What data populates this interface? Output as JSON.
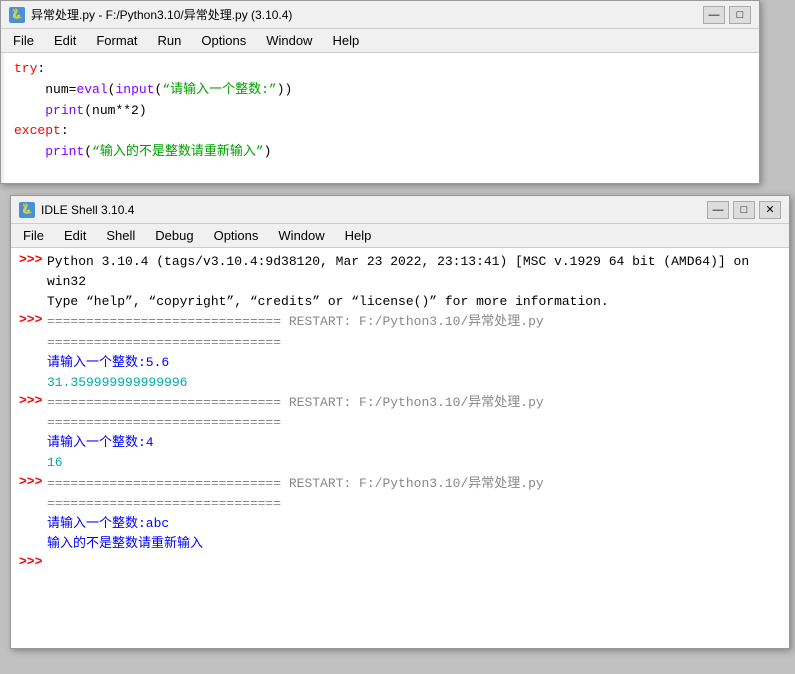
{
  "editor": {
    "titlebar": {
      "title": "异常处理.py - F:/Python3.10/异常处理.py (3.10.4)",
      "icon_label": "py"
    },
    "menu": [
      "File",
      "Edit",
      "Format",
      "Run",
      "Options",
      "Window",
      "Help"
    ],
    "code_lines": [
      {
        "indent": 0,
        "parts": [
          {
            "text": "try",
            "color": "red"
          },
          {
            "text": ":",
            "color": "black"
          }
        ]
      },
      {
        "indent": 1,
        "parts": [
          {
            "text": "num",
            "color": "black"
          },
          {
            "text": "=",
            "color": "black"
          },
          {
            "text": "eval",
            "color": "purple"
          },
          {
            "text": "(",
            "color": "black"
          },
          {
            "text": "input",
            "color": "purple"
          },
          {
            "text": "(",
            "color": "black"
          },
          {
            "text": "“请输入一个整数:”",
            "color": "green"
          },
          {
            "text": "))",
            "color": "black"
          }
        ]
      },
      {
        "indent": 1,
        "parts": [
          {
            "text": "print",
            "color": "purple"
          },
          {
            "text": "(",
            "color": "black"
          },
          {
            "text": "num**2",
            "color": "black"
          },
          {
            "text": ")",
            "color": "black"
          }
        ]
      },
      {
        "indent": 0,
        "parts": [
          {
            "text": "except",
            "color": "red"
          },
          {
            "text": ":",
            "color": "black"
          }
        ]
      },
      {
        "indent": 1,
        "parts": [
          {
            "text": "print",
            "color": "purple"
          },
          {
            "text": "(",
            "color": "black"
          },
          {
            "text": "“输入的不是整数请重新输入”",
            "color": "green"
          },
          {
            "text": ")",
            "color": "black"
          }
        ]
      }
    ]
  },
  "shell": {
    "titlebar": {
      "title": "IDLE Shell 3.10.4",
      "icon_label": "py"
    },
    "menu": [
      "File",
      "Edit",
      "Shell",
      "Debug",
      "Options",
      "Window",
      "Help"
    ],
    "content": {
      "banner_line1": "Python 3.10.4 (tags/v3.10.4:9d38120, Mar 23 2022, 23:13:41) [MSC v.1929 64 bit (AMD64)] on win32",
      "banner_line2": "Type “help”, “copyright”, “credits” or “license()” for more information.",
      "restart1": "============================== RESTART: F:/Python3.10/异常处理.py ==============================",
      "prompt1": "请输入一个整数:5.6",
      "result1": "31.359999999999996",
      "restart2": "============================== RESTART: F:/Python3.10/异常处理.py ==============================",
      "prompt2": "请输入一个整数:4",
      "result2": "16",
      "restart3": "============================== RESTART: F:/Python3.10/异常处理.py ==============================",
      "prompt3": "请输入一个整数:abc",
      "result3": "输入的不是整数请重新输入"
    }
  }
}
